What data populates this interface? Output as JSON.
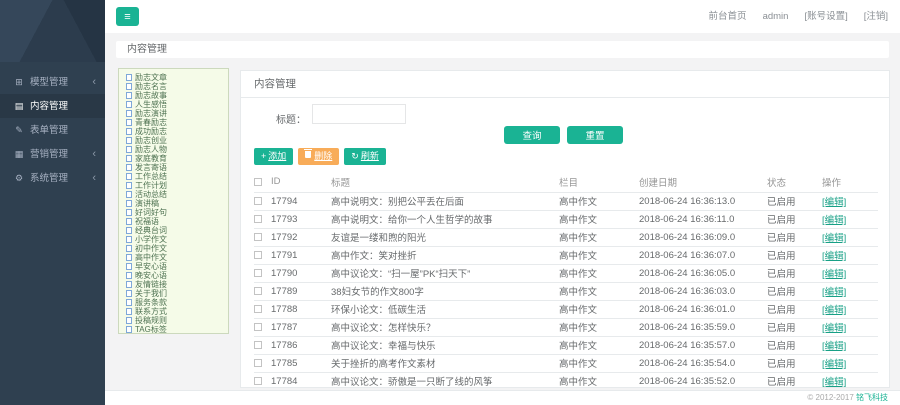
{
  "topbar": {
    "menu_toggle_icon": "≡",
    "links": [
      {
        "key": "frontend-home",
        "label": "前台首页"
      },
      {
        "key": "username",
        "label": "admin"
      },
      {
        "key": "account-settings",
        "label": "[账号设置]"
      },
      {
        "key": "logout",
        "label": "[注销]"
      }
    ]
  },
  "sidebar": {
    "chevron": "‹",
    "items": [
      {
        "key": "model",
        "label": "模型管理",
        "icon": "⊞",
        "icon_name": "grid-icon",
        "has_children": true,
        "active": false
      },
      {
        "key": "content",
        "label": "内容管理",
        "icon": "▤",
        "icon_name": "document-icon",
        "has_children": false,
        "active": true
      },
      {
        "key": "form",
        "label": "表单管理",
        "icon": "✎",
        "icon_name": "pencil-icon",
        "has_children": false,
        "active": false
      },
      {
        "key": "marketing",
        "label": "营销管理",
        "icon": "▦",
        "icon_name": "chart-icon",
        "has_children": true,
        "active": false
      },
      {
        "key": "system",
        "label": "系统管理",
        "icon": "⚙",
        "icon_name": "gear-icon",
        "has_children": true,
        "active": false
      }
    ]
  },
  "breadcrumb": {
    "title": "内容管理"
  },
  "tree": {
    "items": [
      "励志文章",
      "励志名言",
      "励志故事",
      "人生感悟",
      "励志演讲",
      "青春励志",
      "成功励志",
      "励志创业",
      "励志人物",
      "家庭教育",
      "发言寄语",
      "工作总结",
      "工作计划",
      "活动总结",
      "演讲稿",
      "好词好句",
      "祝福语",
      "经典台词",
      "小学作文",
      "初中作文",
      "高中作文",
      "早安心语",
      "晚安心语",
      "友情链接",
      "关于我们",
      "服务条款",
      "联系方式",
      "投稿规则",
      "TAG标签"
    ]
  },
  "panel": {
    "title": "内容管理",
    "search": {
      "label": "标题：",
      "value": "",
      "placeholder": ""
    },
    "query_button": "查询",
    "reset_button": "重置",
    "toolbar": [
      {
        "key": "add",
        "label": "添加",
        "icon": "+",
        "icon_name": "plus-icon",
        "color": "#1ab394"
      },
      {
        "key": "delete",
        "label": "删除",
        "icon": "trash",
        "icon_name": "trash-icon",
        "color": "#f8ac59"
      },
      {
        "key": "refresh",
        "label": "刷新",
        "icon": "↻",
        "icon_name": "refresh-icon",
        "color": "#1ab394"
      }
    ],
    "table": {
      "headers": [
        "ID",
        "标题",
        "栏目",
        "创建日期",
        "状态",
        "操作"
      ],
      "rows": [
        {
          "id": "17794",
          "title": "高中说明文：别把公平丢在后面",
          "category": "高中作文",
          "date": "2018-06-24 16:36:13.0",
          "status": "已启用",
          "action": "[编辑]"
        },
        {
          "id": "17793",
          "title": "高中说明文：给你一个人生哲学的故事",
          "category": "高中作文",
          "date": "2018-06-24 16:36:11.0",
          "status": "已启用",
          "action": "[编辑]"
        },
        {
          "id": "17792",
          "title": "友谊是一缕和煦的阳光",
          "category": "高中作文",
          "date": "2018-06-24 16:36:09.0",
          "status": "已启用",
          "action": "[编辑]"
        },
        {
          "id": "17791",
          "title": "高中作文：笑对挫折",
          "category": "高中作文",
          "date": "2018-06-24 16:36:07.0",
          "status": "已启用",
          "action": "[编辑]"
        },
        {
          "id": "17790",
          "title": "高中议论文：“扫一屋”PK“扫天下”",
          "category": "高中作文",
          "date": "2018-06-24 16:36:05.0",
          "status": "已启用",
          "action": "[编辑]"
        },
        {
          "id": "17789",
          "title": "38妇女节的作文800字",
          "category": "高中作文",
          "date": "2018-06-24 16:36:03.0",
          "status": "已启用",
          "action": "[编辑]"
        },
        {
          "id": "17788",
          "title": "环保小论文：低碳生活",
          "category": "高中作文",
          "date": "2018-06-24 16:36:01.0",
          "status": "已启用",
          "action": "[编辑]"
        },
        {
          "id": "17787",
          "title": "高中议论文：怎样快乐？",
          "category": "高中作文",
          "date": "2018-06-24 16:35:59.0",
          "status": "已启用",
          "action": "[编辑]"
        },
        {
          "id": "17786",
          "title": "高中议论文：幸福与快乐",
          "category": "高中作文",
          "date": "2018-06-24 16:35:57.0",
          "status": "已启用",
          "action": "[编辑]"
        },
        {
          "id": "17785",
          "title": "关于挫折的高考作文素材",
          "category": "高中作文",
          "date": "2018-06-24 16:35:54.0",
          "status": "已启用",
          "action": "[编辑]"
        },
        {
          "id": "17784",
          "title": "高中议论文：骄傲是一只断了线的风筝",
          "category": "高中作文",
          "date": "2018-06-24 16:35:52.0",
          "status": "已启用",
          "action": "[编辑]"
        }
      ]
    }
  },
  "footer": {
    "copyright": "© 2012-2017",
    "company": "铭飞科技"
  },
  "colors": {
    "primary": "#1ab394",
    "warning": "#f8ac59",
    "sidebar": "#2f4050",
    "edit_link": "#17a086"
  }
}
